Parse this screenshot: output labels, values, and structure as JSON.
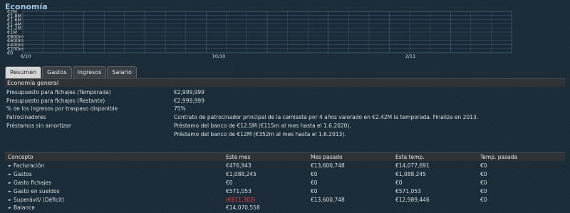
{
  "title": "Economía",
  "chart_data": {
    "type": "line",
    "y_tick_labels": [
      "€2M",
      "€1.8M",
      "€1.6M",
      "€1.4M",
      "€1.2M",
      "€1M",
      "€800m",
      "€600m",
      "€400m",
      "€200m",
      "€0"
    ],
    "x_tick_labels": [
      "6/10",
      "10/10",
      "2/11"
    ],
    "series": []
  },
  "tabs": [
    {
      "label": "Resumen",
      "active": true
    },
    {
      "label": "Gastos",
      "active": false
    },
    {
      "label": "Ingresos",
      "active": false
    },
    {
      "label": "Salario",
      "active": false
    }
  ],
  "general": {
    "header": "Economía general",
    "rows": [
      {
        "label": "Presupuesto para fichajes (Temporada)",
        "value": "€2,999,999"
      },
      {
        "label": "Presupuesto para fichajes (Restante)",
        "value": "€2,999,999"
      },
      {
        "label": "% de los ingresos por traspaso disponible",
        "value": "75%"
      },
      {
        "label": "Patrocinadores",
        "value": "Contrato de patrocinador principal de la camiseta por 4 años valorado en €2.42M la temporada. Finaliza en 2013."
      },
      {
        "label": "Préstamos sin amortizar",
        "value": "Préstamo del banco de €12.5M (€115m al mes hasta el 1.6.2020)."
      },
      {
        "label": "",
        "value": "Préstamo del banco de €12M (€352m al mes hasta el 1.6.2013)."
      }
    ]
  },
  "finance": {
    "headers": [
      "Concepto",
      "Este mes",
      "Mes pasado",
      "Esta temp.",
      "Temp. pasada"
    ],
    "rows": [
      {
        "concept": "Facturación",
        "este_mes": "€476,943",
        "mes_pasado": "€13,600,748",
        "esta_temp": "€14,077,691",
        "temp_pasada": "€0"
      },
      {
        "concept": "Gastos",
        "este_mes": "€1,088,245",
        "mes_pasado": "€0",
        "esta_temp": "€1,088,245",
        "temp_pasada": "€0"
      },
      {
        "concept": "Gasto fichajes",
        "este_mes": "€0",
        "mes_pasado": "€0",
        "esta_temp": "€0",
        "temp_pasada": "€0"
      },
      {
        "concept": "Gasto en sueldos",
        "este_mes": "€571,053",
        "mes_pasado": "€0",
        "esta_temp": "€571,053",
        "temp_pasada": "€0"
      },
      {
        "concept": "Superávit/ (Déficit)",
        "este_mes": "(€611,302)",
        "mes_pasado": "€13,600,748",
        "esta_temp": "€12,989,446",
        "temp_pasada": "€0"
      },
      {
        "concept": "Balance",
        "este_mes": "€14,070,558",
        "mes_pasado": "",
        "esta_temp": "",
        "temp_pasada": ""
      }
    ]
  },
  "colors": {
    "negative": "#ff3b3b",
    "title": "#a4c8e4",
    "grid": "#4d6c80"
  }
}
